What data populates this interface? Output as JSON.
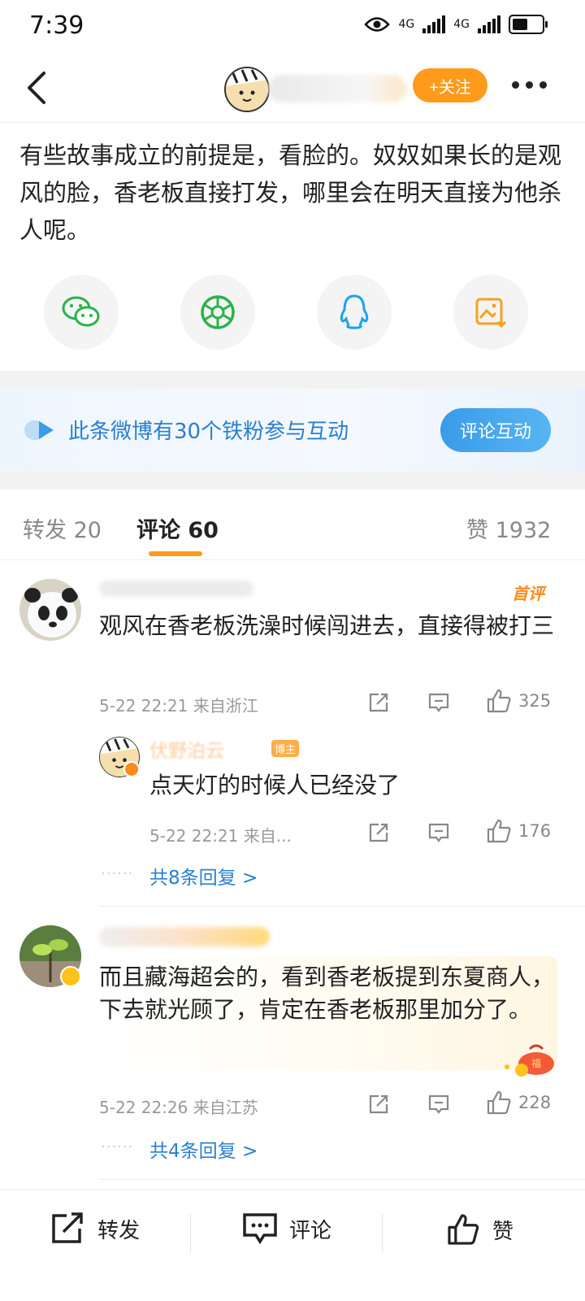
{
  "status_bar": {
    "time": "7:39",
    "net1": "4G",
    "net2": "4G"
  },
  "header": {
    "follow_label": "+关注"
  },
  "post": {
    "text": "有些故事成立的前提是，看脸的。奴奴如果长的是观风的脸，香老板直接打发，哪里会在明天直接为他杀人呢。"
  },
  "share_icons": [
    "wechat-icon",
    "moments-icon",
    "qq-icon",
    "save-image-icon"
  ],
  "banner": {
    "text": "此条微博有30个铁粉参与互动",
    "button": "评论互动"
  },
  "tabs": {
    "repost": "转发 20",
    "comment": "评论 60",
    "like": "赞 1932"
  },
  "comments": [
    {
      "badge": "首评",
      "text": "观风在香老板洗澡时候闯进去，直接得被打三",
      "time_loc": "5-22 22:21 来自浙江",
      "likes": "325",
      "reply": {
        "author_name": "伏野泊云",
        "author_tag": "博主",
        "text": "点天灯的时候人已经没了",
        "time_loc": "5-22 22:21 来自...",
        "likes": "176"
      },
      "more_replies": "共8条回复 >"
    },
    {
      "text": "而且藏海超会的，看到香老板提到东夏商人，下去就光顾了，肯定在香老板那里加分了。",
      "time_loc": "5-22 22:26 来自江苏",
      "likes": "228",
      "more_replies": "共4条回复 >"
    }
  ],
  "bottom_bar": {
    "repost": "转发",
    "comment": "评论",
    "like": "赞"
  },
  "colors": {
    "accent": "#ff9a1a",
    "link": "#2a7fd0"
  }
}
